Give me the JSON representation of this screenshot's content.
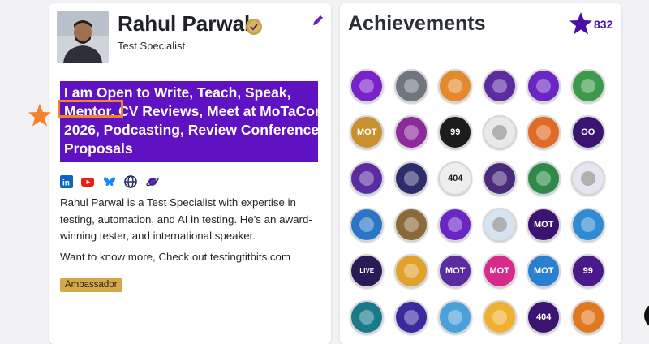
{
  "profile": {
    "name": "Rahul Parwal",
    "role": "Test Specialist",
    "bio_lines": [
      "I am Open to Write, Teach, Speak,",
      "Mentor, CV Reviews, Meet at MoTaCon",
      "2026, Podcasting, Review Conference",
      "Proposals"
    ],
    "description": "Rahul Parwal is a Test Specialist with expertise in testing, automation, and AI in testing. He's an award-winning tester, and international speaker.",
    "more": "Want to know more, Check out testingtitbits.com",
    "badge": "Ambassador",
    "socials": [
      "linkedin-icon",
      "youtube-icon",
      "bluesky-icon",
      "globe-icon",
      "planet-icon"
    ]
  },
  "achievements": {
    "title": "Achievements",
    "count": "832",
    "badges": [
      {
        "name": "professional-member-badge",
        "color": "#7a22c9",
        "label": ""
      },
      {
        "name": "robot-badge",
        "color": "#6f7680",
        "label": ""
      },
      {
        "name": "dino-badge",
        "color": "#e48a2c",
        "label": ""
      },
      {
        "name": "monster-book-badge",
        "color": "#5b2ca0",
        "label": ""
      },
      {
        "name": "testers-planet-badge",
        "color": "#6a26c2",
        "label": ""
      },
      {
        "name": "book-badge",
        "color": "#3d9a4a",
        "label": ""
      },
      {
        "name": "mot-badge",
        "color": "#c8902f",
        "label": "MOT"
      },
      {
        "name": "tester-figure-badge",
        "color": "#8c2a9c",
        "label": ""
      },
      {
        "name": "99-second-talks-badge",
        "color": "#1c1c1c",
        "label": "99"
      },
      {
        "name": "testing-planet-badge",
        "color": "#e9e9e9",
        "label": ""
      },
      {
        "name": "phone-badge",
        "color": "#e06b24",
        "label": ""
      },
      {
        "name": "eyes-badge",
        "color": "#3b1370",
        "label": "OO"
      },
      {
        "name": "newspaper-badge",
        "color": "#5b2ca0",
        "label": ""
      },
      {
        "name": "ambassador-badge",
        "color": "#2d2d6b",
        "label": ""
      },
      {
        "name": "404-talk-badge",
        "color": "#eeeeee",
        "label": "404"
      },
      {
        "name": "octopus-badge",
        "color": "#4a2a7a",
        "label": ""
      },
      {
        "name": "green-monster-badge",
        "color": "#2f8a4a",
        "label": ""
      },
      {
        "name": "blogger-badge",
        "color": "#e8e3f0",
        "label": ""
      },
      {
        "name": "cool-cat-badge",
        "color": "#2c75c4",
        "label": ""
      },
      {
        "name": "explorer-badge",
        "color": "#8a6a3a",
        "label": ""
      },
      {
        "name": "testbash-brighton-badge",
        "color": "#6a26c2",
        "label": ""
      },
      {
        "name": "masks-badge",
        "color": "#d6e3f0",
        "label": ""
      },
      {
        "name": "mot-gold-badge",
        "color": "#3b1370",
        "label": "MOT"
      },
      {
        "name": "monitor-badge",
        "color": "#2f8bd3",
        "label": ""
      },
      {
        "name": "live-badge",
        "color": "#2a1a55",
        "label": "LIVE"
      },
      {
        "name": "bug-badge",
        "color": "#e0a22a",
        "label": ""
      },
      {
        "name": "mot-testers-role-badge",
        "color": "#5b2ca0",
        "label": "MOT"
      },
      {
        "name": "mot-cognitive-biases-badge",
        "color": "#d62b8a",
        "label": "MOT"
      },
      {
        "name": "mot-software-testing-badge",
        "color": "#2a7fd0",
        "label": "MOT"
      },
      {
        "name": "99-badge",
        "color": "#4a1a8a",
        "label": "99"
      },
      {
        "name": "astronaut-badge",
        "color": "#1a7a8a",
        "label": ""
      },
      {
        "name": "planet-badge",
        "color": "#3a2aa0",
        "label": ""
      },
      {
        "name": "detective-badge",
        "color": "#4aa0d8",
        "label": ""
      },
      {
        "name": "open-to-opportunities-badge",
        "color": "#f0b030",
        "label": ""
      },
      {
        "name": "404-badge",
        "color": "#3b1370",
        "label": "404"
      },
      {
        "name": "tiger-badge",
        "color": "#e07820",
        "label": ""
      }
    ]
  },
  "colors": {
    "brand": "#5e12c2",
    "highlight": "#f3822a",
    "badge": "#d3a94a"
  }
}
